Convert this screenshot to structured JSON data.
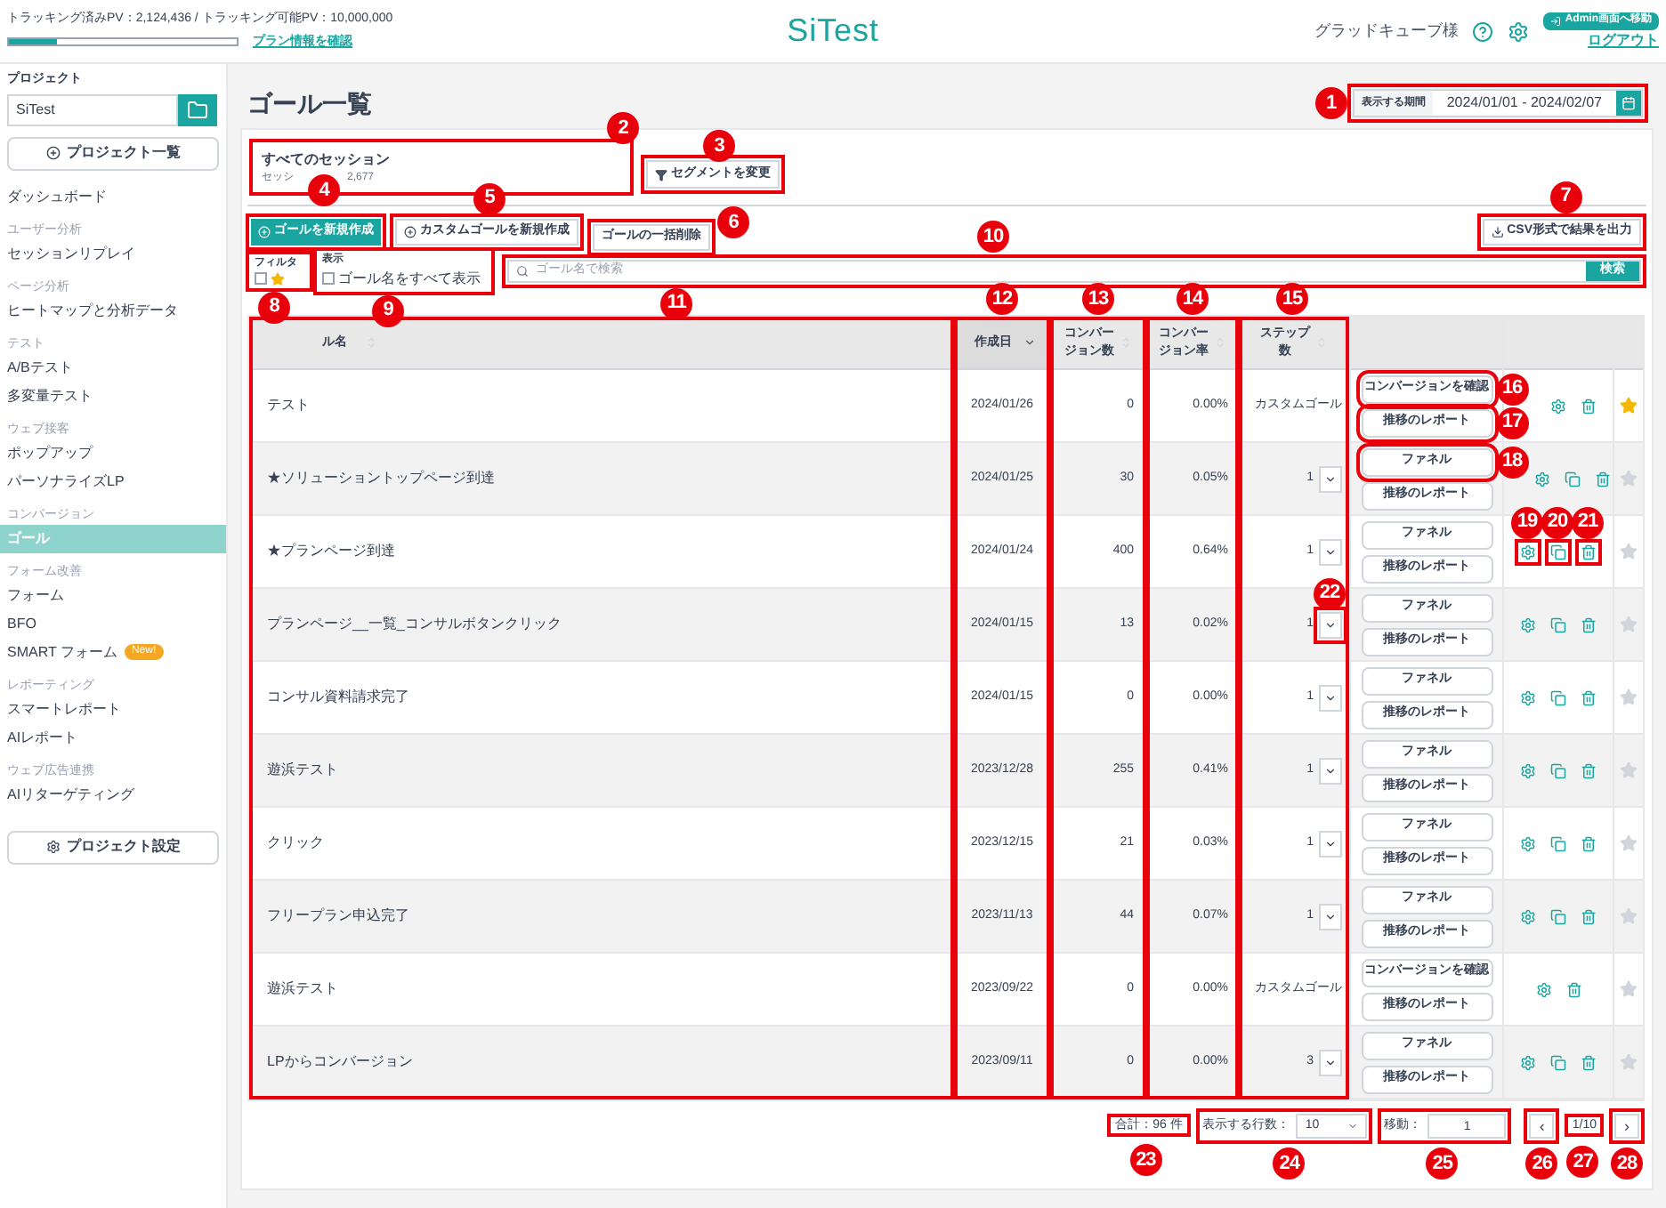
{
  "header": {
    "usage": "トラッキング済みPV：2,124,436 / トラッキング可能PV：10,000,000",
    "usage_meter": {
      "level": 0.21
    },
    "plan_link": "プラン情報を確認",
    "logo": "SiTest",
    "user": "グラッドキューブ様",
    "admin_button": "Admin画面へ移動",
    "logout": "ログアウト"
  },
  "sidebar": {
    "project_label": "プロジェクト",
    "project_value": "SiTest",
    "project_list_button": "プロジェクト一覧",
    "settings_button": "プロジェクト設定",
    "items": [
      {
        "kind": "item",
        "label": "ダッシュボード",
        "selected": false
      },
      {
        "kind": "section",
        "label": "ユーザー分析"
      },
      {
        "kind": "item",
        "label": "セッションリプレイ",
        "selected": false
      },
      {
        "kind": "section",
        "label": "ページ分析"
      },
      {
        "kind": "item",
        "label": "ヒートマップと分析データ",
        "selected": false
      },
      {
        "kind": "section",
        "label": "テスト"
      },
      {
        "kind": "item",
        "label": "A/Bテスト",
        "selected": false
      },
      {
        "kind": "item",
        "label": "多変量テスト",
        "selected": false
      },
      {
        "kind": "section",
        "label": "ウェブ接客"
      },
      {
        "kind": "item",
        "label": "ポップアップ",
        "selected": false
      },
      {
        "kind": "item",
        "label": "パーソナライズLP",
        "selected": false
      },
      {
        "kind": "section",
        "label": "コンバージョン"
      },
      {
        "kind": "item",
        "label": "ゴール",
        "selected": true
      },
      {
        "kind": "section",
        "label": "フォーム改善"
      },
      {
        "kind": "item",
        "label": "フォーム",
        "selected": false
      },
      {
        "kind": "item",
        "label": "BFO",
        "selected": false
      },
      {
        "kind": "item",
        "label": "SMART フォーム",
        "selected": false,
        "badge": "New!"
      },
      {
        "kind": "section",
        "label": "レポーティング"
      },
      {
        "kind": "item",
        "label": "スマートレポート",
        "selected": false
      },
      {
        "kind": "item",
        "label": "AIレポート",
        "selected": false
      },
      {
        "kind": "section",
        "label": "ウェブ広告連携"
      },
      {
        "kind": "item",
        "label": "AIリターゲティング",
        "selected": false
      }
    ]
  },
  "page": {
    "title": "ゴール一覧",
    "period_label": "表示する期間",
    "period_value": "2024/01/01 - 2024/02/07"
  },
  "segment": {
    "title": "すべてのセッション",
    "subtitle": "セッシ",
    "count": "2,677",
    "change_button": "セグメントを変更"
  },
  "actions": {
    "new_goal": "ゴールを新規作成",
    "new_custom_goal": "カスタムゴールを新規作成",
    "bulk_delete": "ゴールの一括削除",
    "csv": "CSV形式で結果を出力"
  },
  "filters": {
    "filter_label": "フィルタ",
    "star_checked": false,
    "display_label": "表示",
    "show_all_label": "ゴール名をすべて表示",
    "show_all_checked": false,
    "search_placeholder": "ゴール名で検索",
    "search_button": "検索"
  },
  "table": {
    "columns": [
      {
        "label": "ル名",
        "sorted": false
      },
      {
        "label": "作成日",
        "sorted": true
      },
      {
        "label": "コンバージョン数",
        "sorted": false
      },
      {
        "label": "コンバージョン率",
        "sorted": false
      },
      {
        "label": "ステップ数",
        "sorted": false
      }
    ],
    "rows": [
      {
        "kind": "custom",
        "name": "テスト",
        "date": "2024/01/26",
        "count": "0",
        "rate": "0.00%",
        "steps": "カスタムゴール",
        "buttons": [
          "コンバージョンを確認",
          "推移のレポート"
        ],
        "starred": true
      },
      {
        "kind": "funnel",
        "name": "★ソリューショントップページ到達",
        "date": "2024/01/25",
        "count": "30",
        "rate": "0.05%",
        "steps": "1",
        "buttons": [
          "ファネル",
          "推移のレポート"
        ],
        "starred": false
      },
      {
        "kind": "funnel",
        "name": "★プランページ到達",
        "date": "2024/01/24",
        "count": "400",
        "rate": "0.64%",
        "steps": "1",
        "buttons": [
          "ファネル",
          "推移のレポート"
        ],
        "starred": false
      },
      {
        "kind": "funnel",
        "name": "プランページ__一覧_コンサルボタンクリック",
        "date": "2024/01/15",
        "count": "13",
        "rate": "0.02%",
        "steps": "1",
        "buttons": [
          "ファネル",
          "推移のレポート"
        ],
        "starred": false
      },
      {
        "kind": "funnel",
        "name": "コンサル資料請求完了",
        "date": "2024/01/15",
        "count": "0",
        "rate": "0.00%",
        "steps": "1",
        "buttons": [
          "ファネル",
          "推移のレポート"
        ],
        "starred": false
      },
      {
        "kind": "funnel",
        "name": "遊浜テスト",
        "date": "2023/12/28",
        "count": "255",
        "rate": "0.41%",
        "steps": "1",
        "buttons": [
          "ファネル",
          "推移のレポート"
        ],
        "starred": false
      },
      {
        "kind": "funnel",
        "name": "クリック",
        "date": "2023/12/15",
        "count": "21",
        "rate": "0.03%",
        "steps": "1",
        "buttons": [
          "ファネル",
          "推移のレポート"
        ],
        "starred": false
      },
      {
        "kind": "funnel",
        "name": "フリープラン申込完了",
        "date": "2023/11/13",
        "count": "44",
        "rate": "0.07%",
        "steps": "1",
        "buttons": [
          "ファネル",
          "推移のレポート"
        ],
        "starred": false
      },
      {
        "kind": "custom",
        "name": "遊浜テスト",
        "date": "2023/09/22",
        "count": "0",
        "rate": "0.00%",
        "steps": "カスタムゴール",
        "buttons": [
          "コンバージョンを確認",
          "推移のレポート"
        ],
        "starred": false
      },
      {
        "kind": "funnel",
        "name": "LPからコンバージョン",
        "date": "2023/09/11",
        "count": "0",
        "rate": "0.00%",
        "steps": "3",
        "buttons": [
          "ファネル",
          "推移のレポート"
        ],
        "starred": false
      }
    ]
  },
  "pagination": {
    "total": "合計：96 件",
    "rows_label": "表示する行数：",
    "rows_value": "10",
    "jump_label": "移動：",
    "jump_value": "1",
    "prev": "‹",
    "page": "1/10",
    "next": "›"
  },
  "callouts": [
    "1",
    "2",
    "3",
    "4",
    "5",
    "6",
    "7",
    "8",
    "9",
    "10",
    "11",
    "12",
    "13",
    "14",
    "15",
    "16",
    "17",
    "18",
    "19",
    "20",
    "21",
    "22",
    "23",
    "24",
    "25",
    "26",
    "27",
    "28"
  ]
}
